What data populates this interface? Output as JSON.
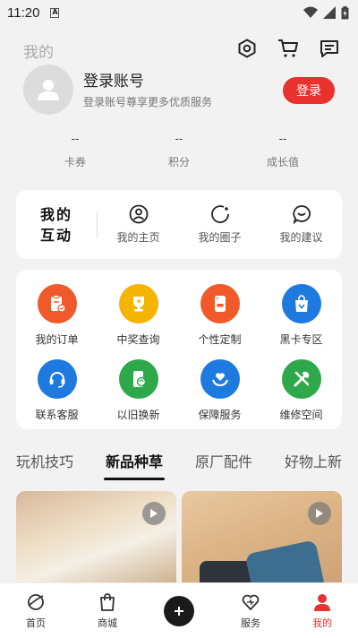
{
  "status_bar": {
    "time": "11:20",
    "notif_letter": "A"
  },
  "header": {
    "title": "我的"
  },
  "profile": {
    "name": "登录账号",
    "subtitle": "登录账号尊享更多优质服务",
    "login_label": "登录"
  },
  "stats": [
    {
      "value": "--",
      "label": "卡券"
    },
    {
      "value": "--",
      "label": "积分"
    },
    {
      "value": "--",
      "label": "成长值"
    }
  ],
  "interact": {
    "title_line1": "我的",
    "title_line2": "互动",
    "items": [
      {
        "label": "我的主页",
        "icon": "user-icon"
      },
      {
        "label": "我的圈子",
        "icon": "circle-icon"
      },
      {
        "label": "我的建议",
        "icon": "chat-icon"
      }
    ]
  },
  "services": [
    {
      "label": "我的订单",
      "icon": "order-icon",
      "color": "#f05a2a"
    },
    {
      "label": "中奖查询",
      "icon": "trophy-icon",
      "color": "#f5b400"
    },
    {
      "label": "个性定制",
      "icon": "diy-icon",
      "color": "#f05a2a"
    },
    {
      "label": "黑卡专区",
      "icon": "bag-icon",
      "color": "#1f7ae0"
    },
    {
      "label": "联系客服",
      "icon": "headset-icon",
      "color": "#1f7ae0"
    },
    {
      "label": "以旧换新",
      "icon": "trade-in-icon",
      "color": "#2ea84a"
    },
    {
      "label": "保障服务",
      "icon": "heart-hand-icon",
      "color": "#1f7ae0"
    },
    {
      "label": "维修空间",
      "icon": "tools-icon",
      "color": "#2ea84a"
    }
  ],
  "tabs": [
    {
      "label": "玩机技巧"
    },
    {
      "label": "新品种草",
      "active": true
    },
    {
      "label": "原厂配件"
    },
    {
      "label": "好物上新"
    }
  ],
  "tabbar": [
    {
      "label": "首页",
      "icon": "planet-icon"
    },
    {
      "label": "商城",
      "icon": "shopping-bag-icon"
    },
    {
      "label": "",
      "icon": "plus-icon"
    },
    {
      "label": "服务",
      "icon": "heart-icon"
    },
    {
      "label": "我的",
      "icon": "person-icon",
      "active": true
    }
  ],
  "colors": {
    "accent": "#e8322d",
    "background": "#f2f2f2"
  }
}
